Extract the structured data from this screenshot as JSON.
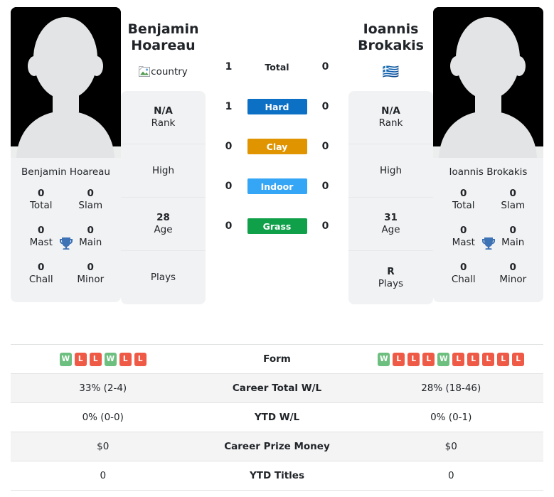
{
  "colors": {
    "hard": "#0c70c5",
    "clay": "#e09400",
    "indoor": "#35a5f5",
    "grass": "#11a04a",
    "win": "#6dbf7f",
    "loss": "#ee5a45",
    "trophy": "#3d72b4"
  },
  "players": {
    "left": {
      "name_line1": "Benjamin",
      "name_line2": "Hoareau",
      "full_name": "Benjamin Hoareau",
      "flag_alt": "country",
      "avatar_alt": "player-photo",
      "info": [
        {
          "value": "N/A",
          "label": "Rank"
        },
        {
          "value": "",
          "label": "High"
        },
        {
          "value": "28",
          "label": "Age"
        },
        {
          "value": "",
          "label": "Plays"
        }
      ],
      "titles": [
        {
          "value": "0",
          "label": "Total"
        },
        {
          "value": "0",
          "label": "Slam"
        },
        {
          "value": "0",
          "label": "Mast"
        },
        {
          "value": "0",
          "label": "Main"
        },
        {
          "value": "0",
          "label": "Chall"
        },
        {
          "value": "0",
          "label": "Minor"
        }
      ],
      "form": [
        "W",
        "L",
        "L",
        "W",
        "L",
        "L"
      ]
    },
    "right": {
      "name_line1": "Ioannis",
      "name_line2": "Brokakis",
      "full_name": "Ioannis Brokakis",
      "flag_emoji": "🇬🇷",
      "avatar_alt": "player-photo",
      "info": [
        {
          "value": "N/A",
          "label": "Rank"
        },
        {
          "value": "",
          "label": "High"
        },
        {
          "value": "31",
          "label": "Age"
        },
        {
          "value": "R",
          "label": "Plays"
        }
      ],
      "titles": [
        {
          "value": "0",
          "label": "Total"
        },
        {
          "value": "0",
          "label": "Slam"
        },
        {
          "value": "0",
          "label": "Mast"
        },
        {
          "value": "0",
          "label": "Main"
        },
        {
          "value": "0",
          "label": "Chall"
        },
        {
          "value": "0",
          "label": "Minor"
        }
      ],
      "form": [
        "W",
        "L",
        "L",
        "L",
        "W",
        "L",
        "L",
        "L",
        "L",
        "L"
      ]
    }
  },
  "surfaces": [
    {
      "label": "Total",
      "left": "1",
      "right": "0",
      "style": "plain",
      "color": ""
    },
    {
      "label": "Hard",
      "left": "1",
      "right": "0",
      "style": "chip",
      "color": "#0c70c5"
    },
    {
      "label": "Clay",
      "left": "0",
      "right": "0",
      "style": "chip",
      "color": "#e09400"
    },
    {
      "label": "Indoor",
      "left": "0",
      "right": "0",
      "style": "chip",
      "color": "#35a5f5"
    },
    {
      "label": "Grass",
      "left": "0",
      "right": "0",
      "style": "chip",
      "color": "#11a04a"
    }
  ],
  "stats": [
    {
      "label": "Form",
      "left": "",
      "right": "",
      "type": "form"
    },
    {
      "label": "Career Total W/L",
      "left": "33% (2-4)",
      "right": "28% (18-46)",
      "type": "text"
    },
    {
      "label": "YTD W/L",
      "left": "0% (0-0)",
      "right": "0% (0-1)",
      "type": "text"
    },
    {
      "label": "Career Prize Money",
      "left": "$0",
      "right": "$0",
      "type": "text"
    },
    {
      "label": "YTD Titles",
      "left": "0",
      "right": "0",
      "type": "text"
    }
  ]
}
